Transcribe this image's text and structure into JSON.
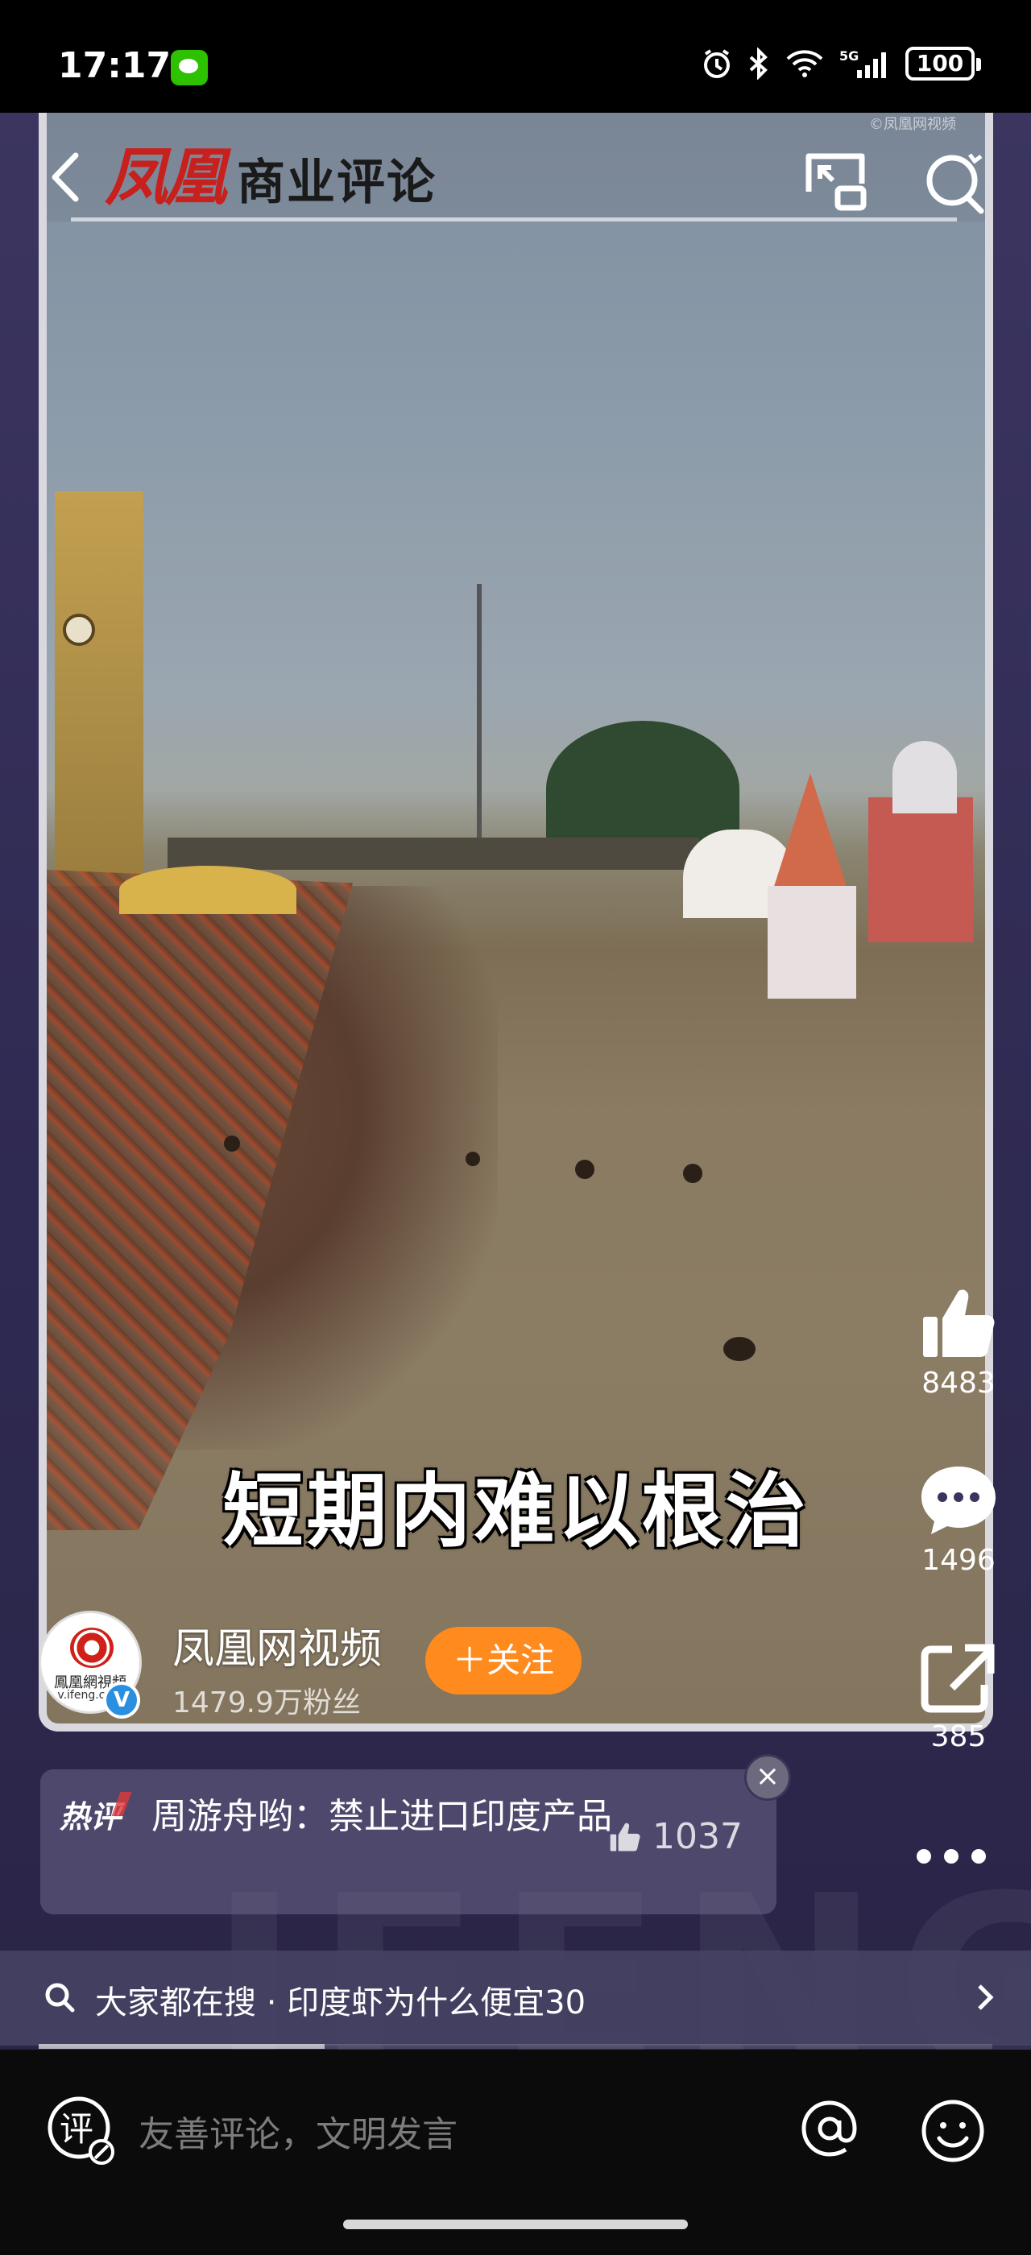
{
  "status_bar": {
    "time": "17:17",
    "network": "5G",
    "battery": "100",
    "icons": [
      "wechat-icon",
      "alarm-icon",
      "bluetooth-icon",
      "wifi-icon",
      "signal-icon",
      "battery-icon"
    ]
  },
  "video": {
    "brand_main": "凤凰",
    "brand_sub": "商业评论",
    "corner_watermark": "©凤凰网视频",
    "subtitle": "短期内难以根治",
    "progress": 0.3
  },
  "channel": {
    "avatar_text": "鳳凰網視頻",
    "avatar_url": "v.ifeng.com",
    "name": "凤凰网视频",
    "fans": "1479.9万粉丝",
    "follow_label": "关注",
    "verified_mark": "V"
  },
  "actions": {
    "likes": "8483",
    "comments": "1496",
    "shares": "385"
  },
  "hot_comment": {
    "tag": "热评",
    "text": "周游舟哟：禁止进口印度产品",
    "likes": "1037"
  },
  "search_hint": {
    "text": "大家都在搜 · 印度虾为什么便宜30"
  },
  "comment_bar": {
    "icon_label": "评",
    "placeholder": "友善评论，文明发言"
  },
  "background_watermark": "IFENG",
  "colors": {
    "brand_red": "#c8201c",
    "follow_orange": "#ff8a1e",
    "verified_blue": "#2b8fe0",
    "stage_purple": "#2f2a52"
  }
}
